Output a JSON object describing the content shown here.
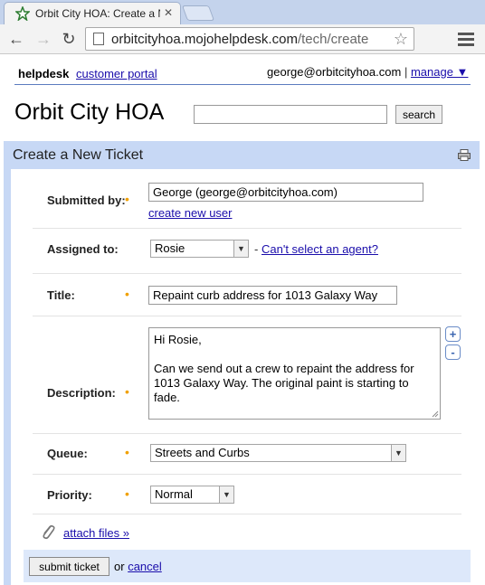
{
  "browser": {
    "tab_title": "Orbit City HOA: Create a N",
    "url_host": "orbitcityhoa.mojohelpdesk.com",
    "url_path": "/tech/create"
  },
  "header": {
    "brand": "helpdesk",
    "portal_link": "customer portal",
    "user_email": "george@orbitcityhoa.com",
    "separator": "|",
    "manage_label": "manage ▼"
  },
  "site": {
    "title": "Orbit City HOA",
    "search_button": "search",
    "search_value": ""
  },
  "panel": {
    "title": "Create a New Ticket"
  },
  "form": {
    "submitted_by": {
      "label": "Submitted by:",
      "value": "George (george@orbitcityhoa.com)",
      "create_user_link": "create new user"
    },
    "assigned_to": {
      "label": "Assigned to:",
      "value": "Rosie",
      "dash": "-",
      "help_link": "Can't select an agent?"
    },
    "title": {
      "label": "Title:",
      "value": "Repaint curb address for 1013 Galaxy Way"
    },
    "description": {
      "label": "Description:",
      "value": "Hi Rosie,\n\nCan we send out a crew to repaint the address for 1013 Galaxy Way. The original paint is starting to fade.",
      "expand": "+",
      "shrink": "-"
    },
    "queue": {
      "label": "Queue:",
      "value": "Streets and Curbs"
    },
    "priority": {
      "label": "Priority:",
      "value": "Normal"
    },
    "required_marker": "•",
    "attach_link": "attach files »"
  },
  "footer": {
    "submit_label": "submit ticket",
    "or_text": "or",
    "cancel_link": "cancel"
  }
}
